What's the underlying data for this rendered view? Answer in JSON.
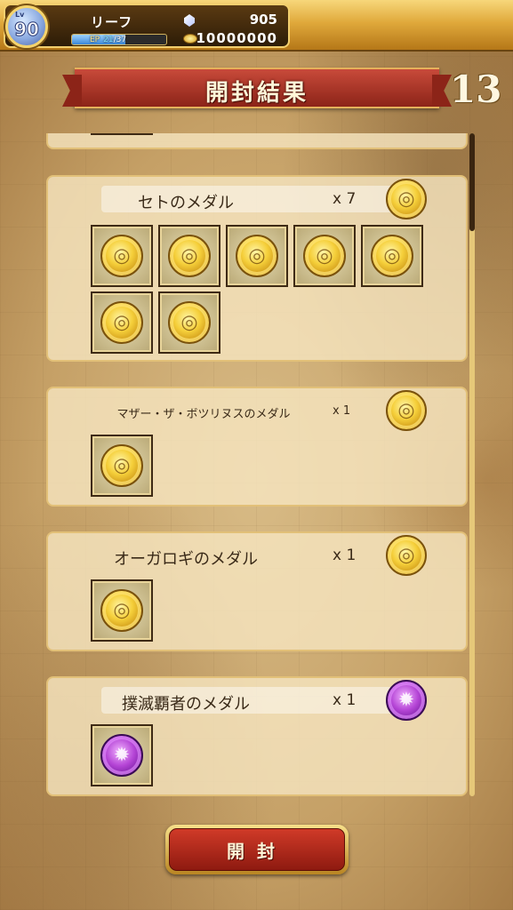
{
  "status": {
    "level_label": "Lv",
    "level": "90",
    "player_name": "リーフ",
    "ep_label": "EP",
    "ep_current": "21",
    "ep_max": "/37",
    "ep_fraction": 0.57,
    "gems": "905",
    "gold": "10000000"
  },
  "header": {
    "title": "開封結果",
    "count": "13"
  },
  "cards": [
    {
      "name": "セトのメダル",
      "qty": "x 7",
      "medal_color": "gold",
      "tile_count": 7
    },
    {
      "name": "マザー・ザ・ボツリヌスのメダル",
      "qty": "x 1",
      "medal_color": "gold",
      "tile_count": 1
    },
    {
      "name": "オーガロギのメダル",
      "qty": "x 1",
      "medal_color": "gold",
      "tile_count": 1
    },
    {
      "name": "撲滅覇者のメダル",
      "qty": "x 1",
      "medal_color": "purple",
      "tile_count": 1
    }
  ],
  "open_button_label": "開封",
  "icons": {
    "gem": "crystal-icon",
    "gold": "coin-icon",
    "medal_gold": "gold-medal-icon",
    "medal_purple": "purple-medal-icon"
  }
}
